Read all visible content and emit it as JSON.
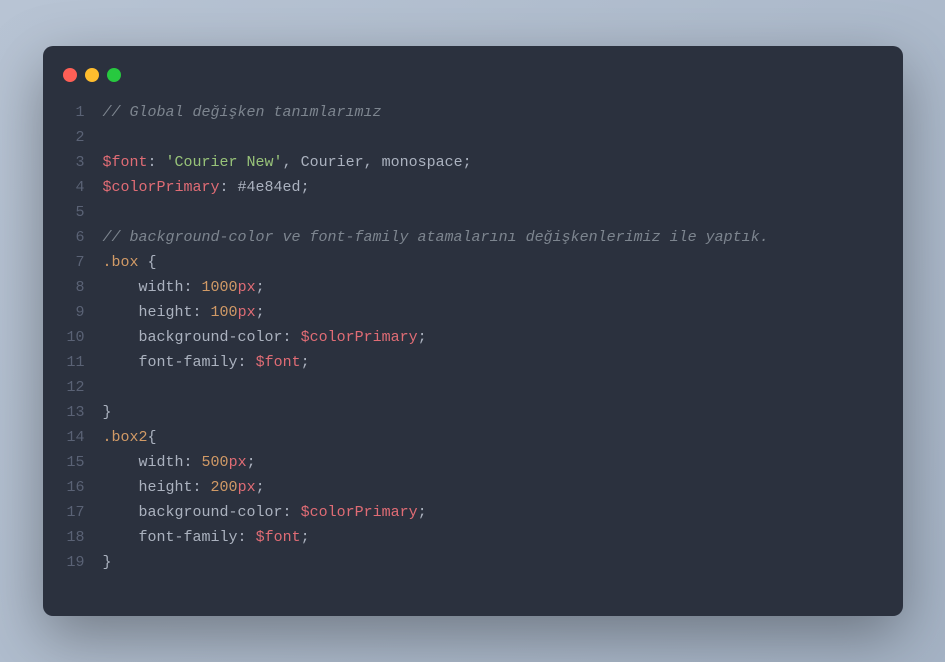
{
  "window": {
    "dots": [
      "red",
      "yellow",
      "green"
    ]
  },
  "code": {
    "total_lines": 19,
    "lines": [
      {
        "n": 1,
        "tokens": [
          {
            "t": "// Global değişken tanımlarımız",
            "c": "tok-comment"
          }
        ]
      },
      {
        "n": 2,
        "tokens": []
      },
      {
        "n": 3,
        "tokens": [
          {
            "t": "$font",
            "c": "tok-var"
          },
          {
            "t": ": ",
            "c": "tok-punct"
          },
          {
            "t": "'Courier New'",
            "c": "tok-string"
          },
          {
            "t": ", Courier, monospace",
            "c": "tok-ident"
          },
          {
            "t": ";",
            "c": "tok-punct"
          }
        ]
      },
      {
        "n": 4,
        "tokens": [
          {
            "t": "$colorPrimary",
            "c": "tok-var"
          },
          {
            "t": ": ",
            "c": "tok-punct"
          },
          {
            "t": "#4e84ed",
            "c": "tok-ident"
          },
          {
            "t": ";",
            "c": "tok-punct"
          }
        ]
      },
      {
        "n": 5,
        "tokens": []
      },
      {
        "n": 6,
        "tokens": [
          {
            "t": "// background-color ve font-family atamalarını değişkenlerimiz ile yaptık.",
            "c": "tok-comment"
          }
        ]
      },
      {
        "n": 7,
        "tokens": [
          {
            "t": ".box",
            "c": "tok-class"
          },
          {
            "t": " {",
            "c": "tok-punct"
          }
        ]
      },
      {
        "n": 8,
        "tokens": [
          {
            "t": "    ",
            "c": "tok-punct"
          },
          {
            "t": "width",
            "c": "tok-prop"
          },
          {
            "t": ": ",
            "c": "tok-punct"
          },
          {
            "t": "1000",
            "c": "tok-number"
          },
          {
            "t": "px",
            "c": "tok-unit"
          },
          {
            "t": ";",
            "c": "tok-punct"
          }
        ]
      },
      {
        "n": 9,
        "tokens": [
          {
            "t": "    ",
            "c": "tok-punct"
          },
          {
            "t": "height",
            "c": "tok-prop"
          },
          {
            "t": ": ",
            "c": "tok-punct"
          },
          {
            "t": "100",
            "c": "tok-number"
          },
          {
            "t": "px",
            "c": "tok-unit"
          },
          {
            "t": ";",
            "c": "tok-punct"
          }
        ]
      },
      {
        "n": 10,
        "tokens": [
          {
            "t": "    ",
            "c": "tok-punct"
          },
          {
            "t": "background-color",
            "c": "tok-prop"
          },
          {
            "t": ": ",
            "c": "tok-punct"
          },
          {
            "t": "$colorPrimary",
            "c": "tok-var"
          },
          {
            "t": ";",
            "c": "tok-punct"
          }
        ]
      },
      {
        "n": 11,
        "tokens": [
          {
            "t": "    ",
            "c": "tok-punct"
          },
          {
            "t": "font-family",
            "c": "tok-prop"
          },
          {
            "t": ": ",
            "c": "tok-punct"
          },
          {
            "t": "$font",
            "c": "tok-var"
          },
          {
            "t": ";",
            "c": "tok-punct"
          }
        ]
      },
      {
        "n": 12,
        "tokens": []
      },
      {
        "n": 13,
        "tokens": [
          {
            "t": "}",
            "c": "tok-punct"
          }
        ]
      },
      {
        "n": 14,
        "tokens": [
          {
            "t": ".box2",
            "c": "tok-class"
          },
          {
            "t": "{",
            "c": "tok-punct"
          }
        ]
      },
      {
        "n": 15,
        "tokens": [
          {
            "t": "    ",
            "c": "tok-punct"
          },
          {
            "t": "width",
            "c": "tok-prop"
          },
          {
            "t": ": ",
            "c": "tok-punct"
          },
          {
            "t": "500",
            "c": "tok-number"
          },
          {
            "t": "px",
            "c": "tok-unit"
          },
          {
            "t": ";",
            "c": "tok-punct"
          }
        ]
      },
      {
        "n": 16,
        "tokens": [
          {
            "t": "    ",
            "c": "tok-punct"
          },
          {
            "t": "height",
            "c": "tok-prop"
          },
          {
            "t": ": ",
            "c": "tok-punct"
          },
          {
            "t": "200",
            "c": "tok-number"
          },
          {
            "t": "px",
            "c": "tok-unit"
          },
          {
            "t": ";",
            "c": "tok-punct"
          }
        ]
      },
      {
        "n": 17,
        "tokens": [
          {
            "t": "    ",
            "c": "tok-punct"
          },
          {
            "t": "background-color",
            "c": "tok-prop"
          },
          {
            "t": ": ",
            "c": "tok-punct"
          },
          {
            "t": "$colorPrimary",
            "c": "tok-var"
          },
          {
            "t": ";",
            "c": "tok-punct"
          }
        ]
      },
      {
        "n": 18,
        "tokens": [
          {
            "t": "    ",
            "c": "tok-punct"
          },
          {
            "t": "font-family",
            "c": "tok-prop"
          },
          {
            "t": ": ",
            "c": "tok-punct"
          },
          {
            "t": "$font",
            "c": "tok-var"
          },
          {
            "t": ";",
            "c": "tok-punct"
          }
        ]
      },
      {
        "n": 19,
        "tokens": [
          {
            "t": "}",
            "c": "tok-punct"
          }
        ]
      }
    ]
  }
}
